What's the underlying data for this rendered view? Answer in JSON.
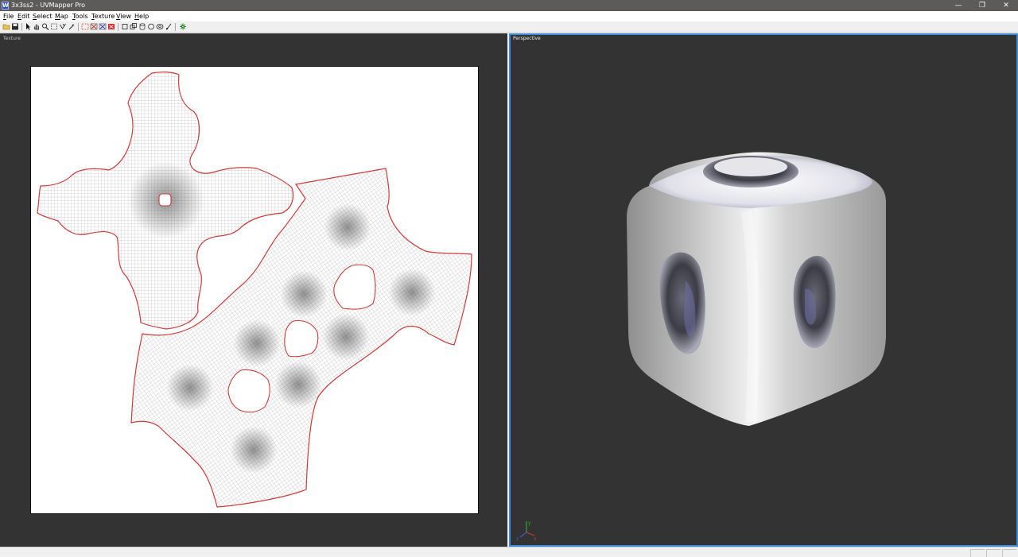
{
  "window": {
    "title": "3x3ss2 - UVMapper Pro",
    "app_icon_glyph": "W",
    "controls": {
      "minimize": "—",
      "restore": "❐",
      "close": "✕"
    }
  },
  "menu": [
    {
      "hot": "F",
      "rest": "ile"
    },
    {
      "hot": "E",
      "rest": "dit"
    },
    {
      "hot": "S",
      "rest": "elect"
    },
    {
      "hot": "M",
      "rest": "ap"
    },
    {
      "hot": "T",
      "rest": "ools"
    },
    {
      "hot": "T",
      "rest": "exture"
    },
    {
      "hot": "V",
      "rest": "iew"
    },
    {
      "hot": "H",
      "rest": "elp"
    }
  ],
  "toolbar": {
    "icons": [
      "open-icon",
      "save-icon",
      "arrow-icon",
      "hand-icon",
      "zoom-icon",
      "rect-select-icon",
      "lasso-icon",
      "magic-wand-icon",
      "marquee-icon",
      "deselect-icon",
      "invert-icon",
      "delete-icon",
      "square-icon",
      "copy-icon",
      "cylinder-icon",
      "sphere-icon",
      "torus-icon",
      "brush-icon",
      "settings-icon"
    ]
  },
  "texture_panel": {
    "label": "Texture",
    "seam_color": "#d03a3a",
    "mesh_color": "#7a7a7a"
  },
  "perspective_panel": {
    "label": "Perspective",
    "active_border_color": "#3d8bd9",
    "axis_labels": {
      "x": "x",
      "y": "y",
      "z": "z"
    }
  },
  "colors": {
    "viewport_bg": "#333333",
    "titlebar_bg": "#5d5b5a"
  }
}
